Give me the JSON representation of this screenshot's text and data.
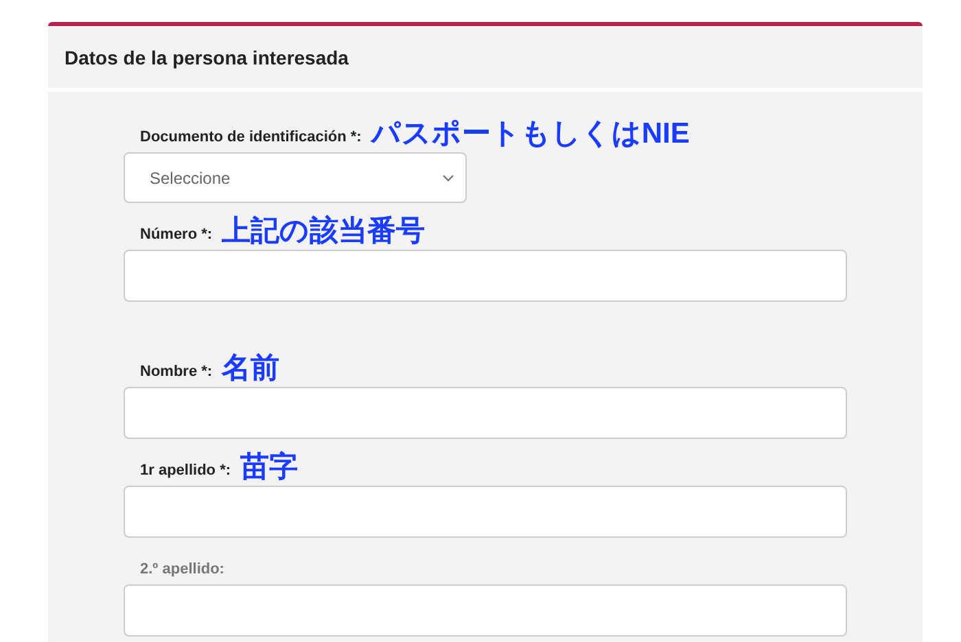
{
  "panel": {
    "title": "Datos de la persona interesada"
  },
  "fields": [
    {
      "label": "Documento de identificación *:",
      "required": true,
      "annotation": "パスポートもしくはNIE",
      "kind": "select",
      "placeholder": "Seleccione"
    },
    {
      "label": "Número *:",
      "required": true,
      "annotation": "上記の該当番号",
      "kind": "text"
    },
    {
      "label": "Nombre *:",
      "required": true,
      "annotation": "名前",
      "kind": "text"
    },
    {
      "label": "1r apellido *:",
      "required": true,
      "annotation": "苗字",
      "kind": "text"
    },
    {
      "label": "2.º apellido:",
      "required": false,
      "kind": "text"
    }
  ]
}
